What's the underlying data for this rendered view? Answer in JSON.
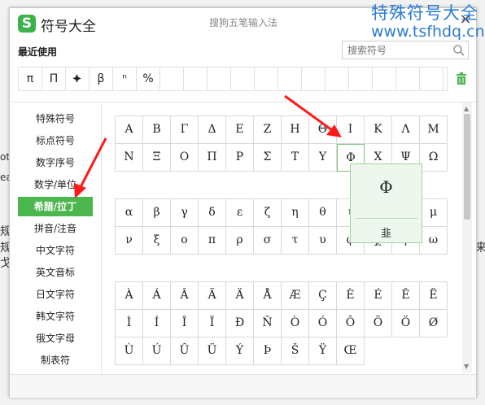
{
  "watermark": {
    "title": "特殊符号大全",
    "url": "www.tsfhdq.cn"
  },
  "background": {
    "fragments": [
      "ote",
      "ea",
      "规",
      "规",
      "戈",
      "来"
    ]
  },
  "dialog": {
    "app_title": "符号大全",
    "ime_name": "搜狗五笔输入法",
    "close_label": "×",
    "recent_label": "最近使用",
    "search_placeholder": "搜索符号",
    "recent_symbols": [
      "π",
      "Π",
      "⯌",
      "β",
      "ⁿ",
      "%",
      "",
      "",
      "",
      "",
      "",
      "",
      "",
      "",
      "",
      "",
      "",
      ""
    ],
    "sidebar": [
      {
        "label": "特殊符号",
        "active": false
      },
      {
        "label": "标点符号",
        "active": false
      },
      {
        "label": "数字序号",
        "active": false
      },
      {
        "label": "数学/单位",
        "active": false
      },
      {
        "label": "希腊/拉丁",
        "active": true
      },
      {
        "label": "拼音/注音",
        "active": false
      },
      {
        "label": "中文字符",
        "active": false
      },
      {
        "label": "英文音标",
        "active": false
      },
      {
        "label": "日文字符",
        "active": false
      },
      {
        "label": "韩文字符",
        "active": false
      },
      {
        "label": "俄文字母",
        "active": false
      },
      {
        "label": "制表符",
        "active": false
      }
    ],
    "greek_upper": [
      "Α",
      "Β",
      "Γ",
      "Δ",
      "Ε",
      "Ζ",
      "Η",
      "Θ",
      "Ι",
      "Κ",
      "Λ",
      "Μ",
      "Ν",
      "Ξ",
      "Ο",
      "Π",
      "Ρ",
      "Σ",
      "Τ",
      "Υ",
      "Φ",
      "Χ",
      "Ψ",
      "Ω"
    ],
    "greek_lower": [
      "α",
      "β",
      "γ",
      "δ",
      "ε",
      "ζ",
      "η",
      "θ",
      "ι",
      "κ",
      "λ",
      "μ",
      "ν",
      "ξ",
      "ο",
      "π",
      "ρ",
      "σ",
      "τ",
      "υ",
      "φ",
      "χ",
      "ψ",
      "ω"
    ],
    "latin": [
      "À",
      "Á",
      "Â",
      "Ã",
      "Ä",
      "Å",
      "Æ",
      "Ç",
      "È",
      "É",
      "Ê",
      "Ë",
      "Ì",
      "Í",
      "Î",
      "Ï",
      "Ð",
      "Ñ",
      "Ò",
      "Ó",
      "Ô",
      "Õ",
      "Ö",
      "Ø",
      "Ù",
      "Ú",
      "Û",
      "Ü",
      "Ý",
      "Þ",
      "Š",
      "Ÿ",
      "Œ"
    ],
    "preview": {
      "char": "Φ",
      "code": "韭"
    },
    "colors": {
      "accent": "#4cb64f",
      "watermark": "#2a7bd6",
      "arrow": "#ff1a1a"
    }
  }
}
